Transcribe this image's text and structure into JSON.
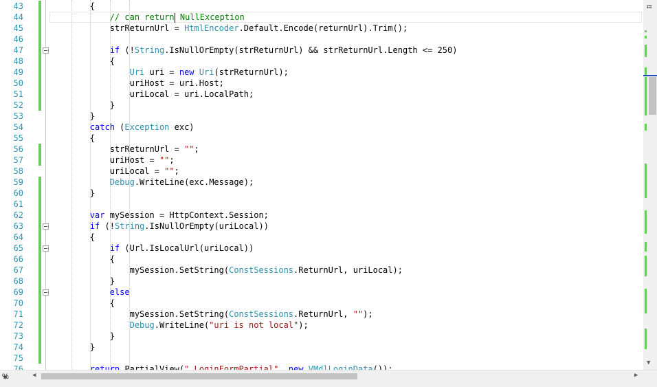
{
  "lines": [
    {
      "n": "43",
      "chg": true,
      "fold": false,
      "tokens": [
        [
          "        {",
          "p"
        ]
      ]
    },
    {
      "n": "44",
      "chg": true,
      "fold": false,
      "cursor": true,
      "tokens": [
        [
          "            ",
          "p"
        ],
        [
          "// can return",
          "cm"
        ],
        [
          "|",
          "caret"
        ],
        [
          " NullException",
          "cm"
        ]
      ]
    },
    {
      "n": "45",
      "chg": true,
      "fold": false,
      "tokens": [
        [
          "            strReturnUrl = ",
          "p"
        ],
        [
          "HtmlEncoder",
          "ty"
        ],
        [
          ".Default.Encode(returnUrl).Trim();",
          "p"
        ]
      ]
    },
    {
      "n": "46",
      "chg": true,
      "fold": false,
      "tokens": [
        [
          "",
          "p"
        ]
      ]
    },
    {
      "n": "47",
      "chg": true,
      "fold": true,
      "tokens": [
        [
          "            ",
          "p"
        ],
        [
          "if",
          "kw"
        ],
        [
          " (!",
          "p"
        ],
        [
          "String",
          "ty"
        ],
        [
          ".IsNullOrEmpty(strReturnUrl) && strReturnUrl.Length <= 250)",
          "p"
        ]
      ]
    },
    {
      "n": "48",
      "chg": true,
      "fold": false,
      "tokens": [
        [
          "            {",
          "p"
        ]
      ]
    },
    {
      "n": "49",
      "chg": true,
      "fold": false,
      "tokens": [
        [
          "                ",
          "p"
        ],
        [
          "Uri",
          "ty"
        ],
        [
          " uri = ",
          "p"
        ],
        [
          "new",
          "kw"
        ],
        [
          " ",
          "p"
        ],
        [
          "Uri",
          "ty"
        ],
        [
          "(strReturnUrl);",
          "p"
        ]
      ]
    },
    {
      "n": "50",
      "chg": true,
      "fold": false,
      "tokens": [
        [
          "                uriHost = uri.Host;",
          "p"
        ]
      ]
    },
    {
      "n": "51",
      "chg": true,
      "fold": false,
      "tokens": [
        [
          "                uriLocal = uri.LocalPath;",
          "p"
        ]
      ]
    },
    {
      "n": "52",
      "chg": true,
      "fold": false,
      "tokens": [
        [
          "            }",
          "p"
        ]
      ]
    },
    {
      "n": "53",
      "chg": false,
      "fold": false,
      "tokens": [
        [
          "        }",
          "p"
        ]
      ]
    },
    {
      "n": "54",
      "chg": false,
      "fold": false,
      "tokens": [
        [
          "        ",
          "p"
        ],
        [
          "catch",
          "kw"
        ],
        [
          " (",
          "p"
        ],
        [
          "Exception",
          "ty"
        ],
        [
          " exc)",
          "p"
        ]
      ]
    },
    {
      "n": "55",
      "chg": false,
      "fold": false,
      "tokens": [
        [
          "        {",
          "p"
        ]
      ]
    },
    {
      "n": "56",
      "chg": true,
      "fold": false,
      "tokens": [
        [
          "            strReturnUrl = ",
          "p"
        ],
        [
          "\"\"",
          "st"
        ],
        [
          ";",
          "p"
        ]
      ]
    },
    {
      "n": "57",
      "chg": true,
      "fold": false,
      "tokens": [
        [
          "            uriHost = ",
          "p"
        ],
        [
          "\"\"",
          "st"
        ],
        [
          ";",
          "p"
        ]
      ]
    },
    {
      "n": "58",
      "chg": false,
      "fold": false,
      "tokens": [
        [
          "            uriLocal = ",
          "p"
        ],
        [
          "\"\"",
          "st"
        ],
        [
          ";",
          "p"
        ]
      ]
    },
    {
      "n": "59",
      "chg": true,
      "fold": false,
      "tokens": [
        [
          "            ",
          "p"
        ],
        [
          "Debug",
          "ty"
        ],
        [
          ".WriteLine(exc.Message);",
          "p"
        ]
      ]
    },
    {
      "n": "60",
      "chg": true,
      "fold": false,
      "tokens": [
        [
          "        }",
          "p"
        ]
      ]
    },
    {
      "n": "61",
      "chg": true,
      "fold": false,
      "tokens": [
        [
          "",
          "p"
        ]
      ]
    },
    {
      "n": "62",
      "chg": true,
      "fold": false,
      "tokens": [
        [
          "        ",
          "p"
        ],
        [
          "var",
          "kw"
        ],
        [
          " mySession = HttpContext.Session;",
          "p"
        ]
      ]
    },
    {
      "n": "63",
      "chg": true,
      "fold": true,
      "tokens": [
        [
          "        ",
          "p"
        ],
        [
          "if",
          "kw"
        ],
        [
          " (!",
          "p"
        ],
        [
          "String",
          "ty"
        ],
        [
          ".IsNullOrEmpty(uriLocal))",
          "p"
        ]
      ]
    },
    {
      "n": "64",
      "chg": true,
      "fold": false,
      "tokens": [
        [
          "        {",
          "p"
        ]
      ]
    },
    {
      "n": "65",
      "chg": true,
      "fold": true,
      "tokens": [
        [
          "            ",
          "p"
        ],
        [
          "if",
          "kw"
        ],
        [
          " (Url.IsLocalUrl(uriLocal))",
          "p"
        ]
      ]
    },
    {
      "n": "66",
      "chg": true,
      "fold": false,
      "tokens": [
        [
          "            {",
          "p"
        ]
      ]
    },
    {
      "n": "67",
      "chg": true,
      "fold": false,
      "tokens": [
        [
          "                mySession.SetString(",
          "p"
        ],
        [
          "ConstSessions",
          "ty"
        ],
        [
          ".ReturnUrl, uriLocal);",
          "p"
        ]
      ]
    },
    {
      "n": "68",
      "chg": true,
      "fold": false,
      "tokens": [
        [
          "            }",
          "p"
        ]
      ]
    },
    {
      "n": "69",
      "chg": true,
      "fold": true,
      "tokens": [
        [
          "            ",
          "p"
        ],
        [
          "else",
          "kw"
        ]
      ]
    },
    {
      "n": "70",
      "chg": true,
      "fold": false,
      "tokens": [
        [
          "            {",
          "p"
        ]
      ]
    },
    {
      "n": "71",
      "chg": true,
      "fold": false,
      "tokens": [
        [
          "                mySession.SetString(",
          "p"
        ],
        [
          "ConstSessions",
          "ty"
        ],
        [
          ".ReturnUrl, ",
          "p"
        ],
        [
          "\"\"",
          "st"
        ],
        [
          ");",
          "p"
        ]
      ]
    },
    {
      "n": "72",
      "chg": true,
      "fold": false,
      "tokens": [
        [
          "                ",
          "p"
        ],
        [
          "Debug",
          "ty"
        ],
        [
          ".WriteLine(",
          "p"
        ],
        [
          "\"uri is not local\"",
          "st"
        ],
        [
          ");",
          "p"
        ]
      ]
    },
    {
      "n": "73",
      "chg": true,
      "fold": false,
      "tokens": [
        [
          "            }",
          "p"
        ]
      ]
    },
    {
      "n": "74",
      "chg": true,
      "fold": false,
      "tokens": [
        [
          "        }",
          "p"
        ]
      ]
    },
    {
      "n": "75",
      "chg": true,
      "fold": false,
      "tokens": [
        [
          "",
          "p"
        ]
      ]
    },
    {
      "n": "76",
      "chg": false,
      "fold": false,
      "tokens": [
        [
          "        ",
          "p"
        ],
        [
          "return",
          "kw"
        ],
        [
          " PartialView(",
          "p"
        ],
        [
          "\"_LoginFormPartial\"",
          "st"
        ],
        [
          ", ",
          "p"
        ],
        [
          "new",
          "kw"
        ],
        [
          " ",
          "p"
        ],
        [
          "VMdlLoginData",
          "ty"
        ],
        [
          "());",
          "p"
        ]
      ]
    }
  ],
  "status": {
    "zoom": "%"
  },
  "icons": {
    "splitter": "split-icon",
    "scroll_up": "chevron-up-icon",
    "scroll_down": "chevron-down-icon",
    "scroll_left": "chevron-left-icon",
    "scroll_right": "chevron-right-icon",
    "zoom_dropdown": "chevron-down-icon"
  },
  "colors": {
    "keyword": "#0000ff",
    "type": "#2b91af",
    "string": "#a31515",
    "comment": "#008000",
    "line_number": "#2b91af",
    "change_bar": "#6ccb5f"
  }
}
